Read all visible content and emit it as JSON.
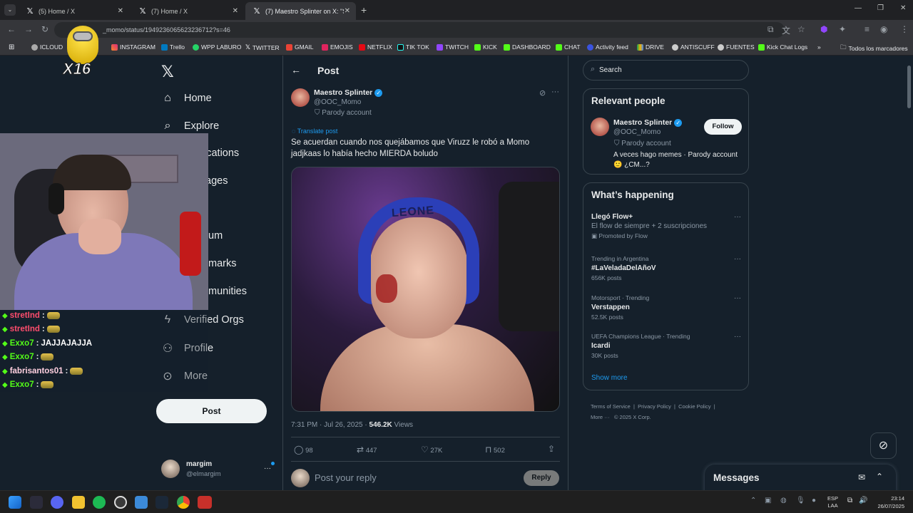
{
  "tabs": [
    {
      "title": "(5) Home / X"
    },
    {
      "title": "(7) Home / X"
    },
    {
      "title": "(7) Maestro Splinter on X: \"Se a"
    }
  ],
  "address": {
    "url": "_momo/status/1949236065623236712?s=46"
  },
  "bookmarks": [
    "ICLOUD",
    "INSTAGRAM",
    "Trello",
    "WPP LABURO",
    "TWITTER",
    "GMAIL",
    "EMOJIS",
    "NETFLIX",
    "TIK TOK",
    "TWITCH",
    "KICK",
    "DASHBOARD",
    "CHAT",
    "Activity feed",
    "DRIVE",
    "ANTISCUFF",
    "FUENTES",
    "Kick Chat Logs"
  ],
  "bookmarks_folder": "Todos los marcadores",
  "overlay_badge": "X16",
  "nav": {
    "items": [
      "Home",
      "Explore",
      "ications",
      "ages",
      "um",
      "marks",
      "munities",
      "Verified Orgs",
      "Profile",
      "More"
    ],
    "post_label": "Post",
    "account_name": "margim",
    "account_handle": "@elmargim"
  },
  "post": {
    "header": "Post",
    "author_name": "Maestro Splinter",
    "author_handle": "@OOC_Momo",
    "parody": "Parody account",
    "translate": "Translate post",
    "text_line1": "Se acuerdan cuando nos quejábamos que Viruzz le robó a Momo",
    "text_line2": "jadjkaas lo había hecho MIERDA boludo",
    "image_headgear_text": "LEONE",
    "timestamp": "7:31 PM · Jul 26, 2025 · ",
    "views_count": "546.2K",
    "views_label": " Views",
    "replies": "98",
    "reposts": "447",
    "likes": "27K",
    "bookmarks": "502",
    "reply_placeholder": "Post your reply",
    "reply_button": "Reply"
  },
  "search": {
    "placeholder": "Search"
  },
  "relevant": {
    "title": "Relevant people",
    "name": "Maestro Splinter",
    "handle": "@OOC_Momo",
    "parody": "Parody account",
    "bio_line1": "A veces hago memes · Parody account",
    "bio_line2": "🙂 ¿CM...?",
    "follow": "Follow"
  },
  "happening": {
    "title": "What’s happening",
    "trends": [
      {
        "context": "",
        "title": "Llegó Flow+",
        "sub": "El flow de siempre + 2 suscripciones",
        "meta": "Promoted by Flow"
      },
      {
        "context": "Trending in Argentina",
        "title": "#LaVeladaDelAñoV",
        "sub": "",
        "meta": "656K posts"
      },
      {
        "context": "Motorsport · Trending",
        "title": "Verstappen",
        "sub": "",
        "meta": "52.5K posts"
      },
      {
        "context": "UEFA Champions League · Trending",
        "title": "Icardi",
        "sub": "",
        "meta": "30K posts"
      }
    ],
    "show_more": "Show more"
  },
  "footer": {
    "links": [
      "Terms of Service",
      "Privacy Policy",
      "Cookie Policy"
    ],
    "more": "More ···",
    "copyright": "© 2025 X Corp."
  },
  "messages": {
    "title": "Messages"
  },
  "chat": [
    {
      "user": "stretInd",
      "text": "",
      "color": "#ff4d6d"
    },
    {
      "user": "stretInd",
      "text": "",
      "color": "#ff4d6d"
    },
    {
      "user": "Exxo7",
      "text": "JAJJAJAJJA",
      "color": "#53fc18"
    },
    {
      "user": "Exxo7",
      "text": "",
      "color": "#53fc18"
    },
    {
      "user": "fabrisantos01",
      "text": "",
      "color": "#ffd0e0"
    },
    {
      "user": "Exxo7",
      "text": "",
      "color": "#53fc18"
    }
  ],
  "taskbar": {
    "lang1": "ESP",
    "lang2": "LAA",
    "time": "23:14",
    "date": "26/07/2025"
  }
}
